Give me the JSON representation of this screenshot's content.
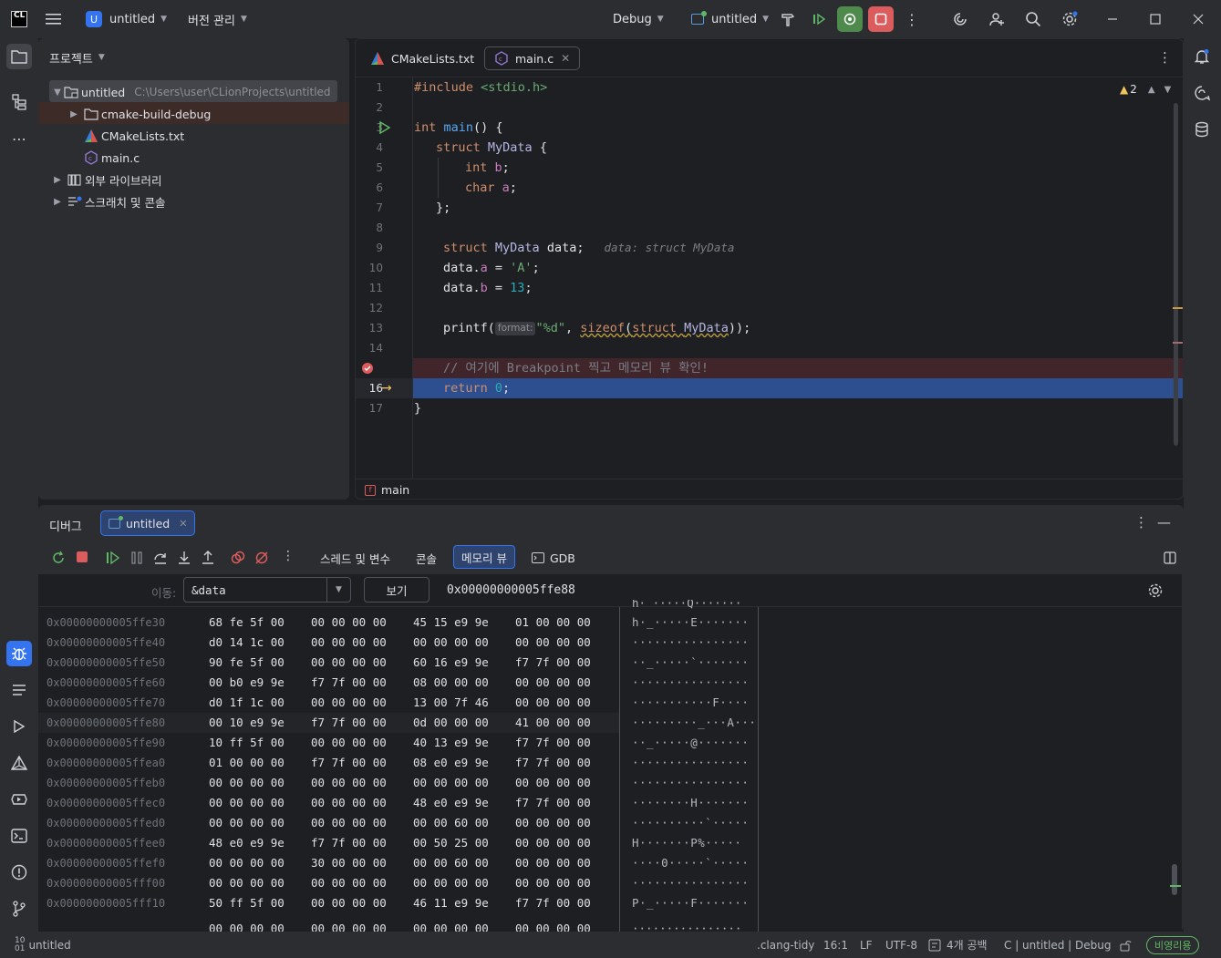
{
  "titlebar": {
    "app_logo": "CL",
    "project_badge": "U",
    "project_name": "untitled",
    "vcs_menu": "버전 관리",
    "run_config": "Debug",
    "run_target": "untitled",
    "icons": [
      "hammer-icon",
      "resume-icon",
      "rerun-debug-icon",
      "stop-icon",
      "more-icon",
      "ai-icon",
      "add-user-icon",
      "search-icon",
      "settings-icon"
    ]
  },
  "project_panel": {
    "title": "프로젝트",
    "tree": [
      {
        "label": "untitled",
        "path": "C:\\Users\\user\\CLionProjects\\untitled"
      },
      {
        "label": "cmake-build-debug"
      },
      {
        "label": "CMakeLists.txt"
      },
      {
        "label": "main.c"
      },
      {
        "label": "외부 라이브러리"
      },
      {
        "label": "스크래치 및 콘솔"
      }
    ]
  },
  "editor": {
    "tabs": [
      {
        "label": "CMakeLists.txt"
      },
      {
        "label": "main.c"
      }
    ],
    "warnings": "2",
    "line_numbers": [
      "1",
      "2",
      "3",
      "4",
      "5",
      "6",
      "7",
      "8",
      "9",
      "10",
      "11",
      "12",
      "13",
      "14",
      "15",
      "16",
      "17"
    ],
    "code": {
      "l1a": "#include ",
      "l1b": "<stdio.h>",
      "l3a": "int ",
      "l3b": "main",
      "l3c": "() {",
      "l4a": "struct ",
      "l4b": "MyData",
      "l4c": " {",
      "l5a": "int ",
      "l5b": "b",
      "l5c": ";",
      "l6a": "char ",
      "l6b": "a",
      "l6c": ";",
      "l7": "};",
      "l9a": "struct ",
      "l9b": "MyData",
      "l9c": " data;",
      "l9hint": "data: struct MyData",
      "l10a": "data.",
      "l10b": "a",
      "l10c": " = ",
      "l10d": "'A'",
      "l10e": ";",
      "l11a": "data.",
      "l11b": "b",
      "l11c": " = ",
      "l11d": "13",
      "l11e": ";",
      "l13a": "printf(",
      "l13pill": "format:",
      "l13b": "\"%d\"",
      "l13c": ", ",
      "l13d": "sizeof",
      "l13e": "(",
      "l13f": "struct ",
      "l13g": "MyData",
      "l13h": "));",
      "l15": "// 여기에 Breakpoint 찍고 메모리 뷰 확인!",
      "l16a": "return ",
      "l16b": "0",
      "l16c": ";",
      "l17": "}"
    },
    "breadcrumb": "main"
  },
  "debug_panel": {
    "title": "디버그",
    "session_tab": "untitled",
    "tabs": [
      "스레드 및 변수",
      "콘솔",
      "메모리 뷰",
      "GDB"
    ],
    "active_tab": "메모리 뷰",
    "goto_label": "이동:",
    "goto_value": "&data",
    "view_button": "보기",
    "current_address": "0x00000000005ffe88",
    "partial_top_ascii": "h·_·····Q·······",
    "partial_bottom_hex": [
      "00 00 00 00",
      "00 00 00 00",
      "00 00 00 00",
      "00 00 00 00"
    ],
    "partial_bottom_ascii": "················",
    "rows": [
      {
        "addr": "0x00000000005ffe30",
        "g1": "68 fe 5f 00",
        "g2": "00 00 00 00",
        "g3": "45 15 e9 9e",
        "g4": "01 00 00 00",
        "ascii": "h·_·····E·······"
      },
      {
        "addr": "0x00000000005ffe40",
        "g1": "d0 14 1c 00",
        "g2": "00 00 00 00",
        "g3": "00 00 00 00",
        "g4": "00 00 00 00",
        "ascii": "················"
      },
      {
        "addr": "0x00000000005ffe50",
        "g1": "90 fe 5f 00",
        "g2": "00 00 00 00",
        "g3": "60 16 e9 9e",
        "g4": "f7 7f 00 00",
        "ascii": "··_·····`·······"
      },
      {
        "addr": "0x00000000005ffe60",
        "g1": "00 b0 e9 9e",
        "g2": "f7 7f 00 00",
        "g3": "08 00 00 00",
        "g4": "00 00 00 00",
        "ascii": "················"
      },
      {
        "addr": "0x00000000005ffe70",
        "g1": "d0 1f 1c 00",
        "g2": "00 00 00 00",
        "g3": "13 00 7f 46",
        "g4": "00 00 00 00",
        "ascii": "···········F····"
      },
      {
        "addr": "0x00000000005ffe80",
        "g1": "00 10 e9 9e",
        "g2": "f7 7f 00 00",
        "g3": "0d 00 00 00",
        "g4": "41 00 00 00",
        "ascii": "·········_···A···"
      },
      {
        "addr": "0x00000000005ffe90",
        "g1": "10 ff 5f 00",
        "g2": "00 00 00 00",
        "g3": "40 13 e9 9e",
        "g4": "f7 7f 00 00",
        "ascii": "··_·····@·······"
      },
      {
        "addr": "0x00000000005ffea0",
        "g1": "01 00 00 00",
        "g2": "f7 7f 00 00",
        "g3": "08 e0 e9 9e",
        "g4": "f7 7f 00 00",
        "ascii": "················"
      },
      {
        "addr": "0x00000000005ffeb0",
        "g1": "00 00 00 00",
        "g2": "00 00 00 00",
        "g3": "00 00 00 00",
        "g4": "00 00 00 00",
        "ascii": "················"
      },
      {
        "addr": "0x00000000005ffec0",
        "g1": "00 00 00 00",
        "g2": "00 00 00 00",
        "g3": "48 e0 e9 9e",
        "g4": "f7 7f 00 00",
        "ascii": "········H·······"
      },
      {
        "addr": "0x00000000005ffed0",
        "g1": "00 00 00 00",
        "g2": "00 00 00 00",
        "g3": "00 00 60 00",
        "g4": "00 00 00 00",
        "ascii": "··········`·····"
      },
      {
        "addr": "0x00000000005ffee0",
        "g1": "48 e0 e9 9e",
        "g2": "f7 7f 00 00",
        "g3": "00 50 25 00",
        "g4": "00 00 00 00",
        "ascii": "H·······P%·····"
      },
      {
        "addr": "0x00000000005ffef0",
        "g1": "00 00 00 00",
        "g2": "30 00 00 00",
        "g3": "00 00 60 00",
        "g4": "00 00 00 00",
        "ascii": "····0·····`·····"
      },
      {
        "addr": "0x00000000005fff00",
        "g1": "00 00 00 00",
        "g2": "00 00 00 00",
        "g3": "00 00 00 00",
        "g4": "00 00 00 00",
        "ascii": "················"
      },
      {
        "addr": "0x00000000005fff10",
        "g1": "50 ff 5f 00",
        "g2": "00 00 00 00",
        "g3": "46 11 e9 9e",
        "g4": "f7 7f 00 00",
        "ascii": "P·_·····F·······"
      }
    ]
  },
  "statusbar": {
    "project": "untitled",
    "lint": ".clang-tidy",
    "position": "16:1",
    "line_ending": "LF",
    "encoding": "UTF-8",
    "indent": "4개 공백",
    "context": "C | untitled | Debug",
    "license": "비영리용"
  },
  "colors": {
    "accent": "#3574f0",
    "breakpoint_line": "#40252b",
    "execution_line": "#2d4f8f",
    "highlight_bytes": "#2b5a3a",
    "stop": "#db5c5c",
    "debug_green": "#4e8a4c"
  }
}
